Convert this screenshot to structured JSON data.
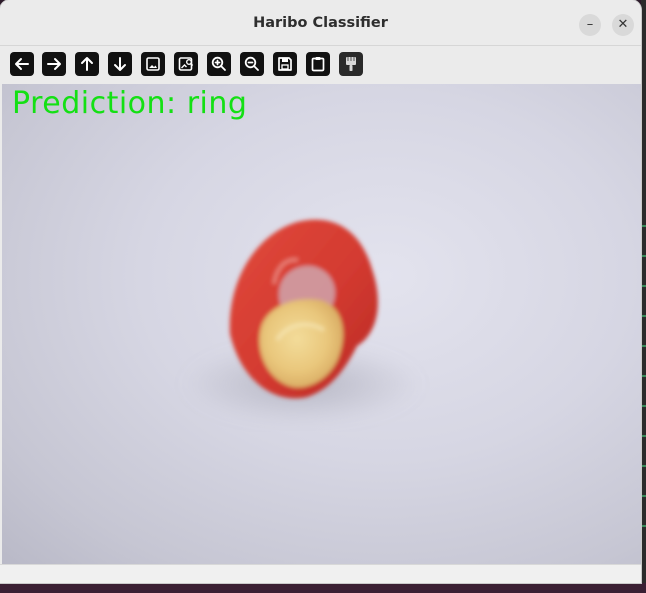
{
  "window": {
    "title": "Haribo Classifier",
    "minimize_glyph": "–",
    "close_glyph": "✕"
  },
  "toolbar": {
    "buttons": [
      {
        "name": "pan-left",
        "icon": "arrow-left-icon"
      },
      {
        "name": "pan-right",
        "icon": "arrow-right-icon"
      },
      {
        "name": "pan-up",
        "icon": "arrow-up-icon"
      },
      {
        "name": "pan-down",
        "icon": "arrow-down-icon"
      },
      {
        "name": "zoom-fit",
        "icon": "image-icon"
      },
      {
        "name": "zoom-original",
        "icon": "image-search-icon"
      },
      {
        "name": "zoom-in",
        "icon": "zoom-in-icon"
      },
      {
        "name": "zoom-out",
        "icon": "zoom-out-icon"
      },
      {
        "name": "save-image",
        "icon": "save-icon"
      },
      {
        "name": "copy-to-clipboard",
        "icon": "clipboard-icon"
      },
      {
        "name": "properties",
        "icon": "brush-icon"
      }
    ]
  },
  "image": {
    "prediction_label": "Prediction:",
    "prediction_value": "ring",
    "text_color": "#14e014"
  }
}
